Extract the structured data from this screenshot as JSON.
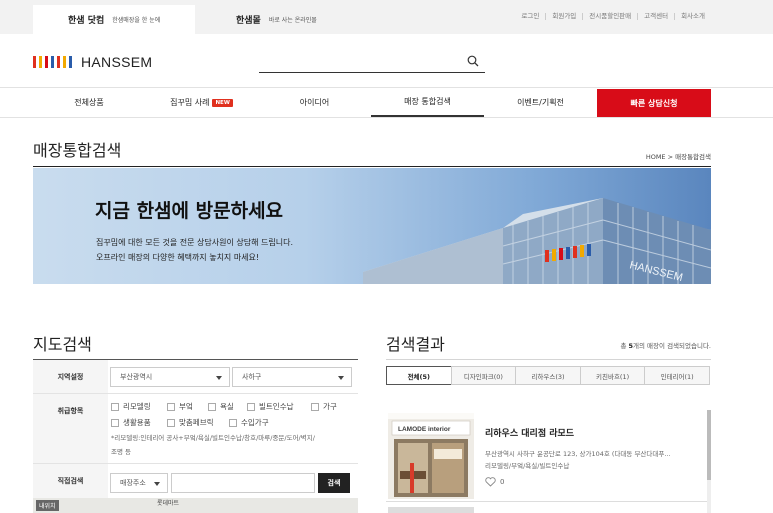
{
  "topbar": {
    "brands": [
      {
        "name": "한샘 닷컴",
        "desc": "한샘매장을 한 눈에"
      },
      {
        "name": "한샘몰",
        "desc": "바로 사는 온라인몰"
      }
    ],
    "util_links": [
      "로그인",
      "회원가입",
      "전시품할인판매",
      "고객센터",
      "회사소개"
    ]
  },
  "header": {
    "logo_text": "HANSSEM",
    "logo_colors": [
      "#e0301e",
      "#f2a900",
      "#d80c18",
      "#2a5caa",
      "#e0301e",
      "#f2a900",
      "#2a5caa"
    ],
    "search_placeholder": ""
  },
  "gnb": {
    "items": [
      "전체상품",
      "집꾸밈 사례",
      "아이디어",
      "매장 통합검색",
      "이벤트/기획전",
      "빠른 상담신청"
    ],
    "new_badge": "NEW"
  },
  "page": {
    "title": "매장통합검색",
    "breadcrumb": "HOME  >  매장통합검색"
  },
  "banner": {
    "headline": "지금 한샘에 방문하세요",
    "line1": "집꾸밈에 대한 모든 것을 전문 상담사원이 상담해 드립니다.",
    "line2": "오프라인 매장의 다양한 혜택까지 놓치지 마세요!"
  },
  "map_search": {
    "title": "지도검색",
    "region_label": "지역설정",
    "region_city": "부산광역시",
    "region_district": "사하구",
    "items_label": "취급항목",
    "checkboxes": [
      "리모델링",
      "부엌",
      "욕실",
      "빌트인수납",
      "가구",
      "생활용품",
      "맞춤페브릭",
      "수입가구"
    ],
    "note_line1": "*리모델링:인테리어 공사+부엌/욕실/빌트인수납/창호/마루/중문/도어/벽지/",
    "note_line2": "조명 등",
    "direct_label": "직접검색",
    "direct_select": "매장주소",
    "search_button": "검색",
    "map_location_badge": "내위치",
    "map_poi": "롯데마트"
  },
  "results": {
    "title": "검색결과",
    "count_prefix": "총 ",
    "count": "5",
    "count_suffix": "개의 매장이 검색되었습니다.",
    "tabs": [
      "전체(5)",
      "디자인파크(0)",
      "리하우스(3)",
      "키친바흐(1)",
      "인테리어(1)"
    ],
    "cards": [
      {
        "name": "리하우스 대리점 라모드",
        "addr_line1": "부산광역시 사하구 윤공단로 123, 상가104호 (다대동 부산다대푸...",
        "addr_line2": "리모델링/부엌/욕실/빌트인수납",
        "likes": "0",
        "sign_text": "LAMODE interior"
      }
    ]
  }
}
